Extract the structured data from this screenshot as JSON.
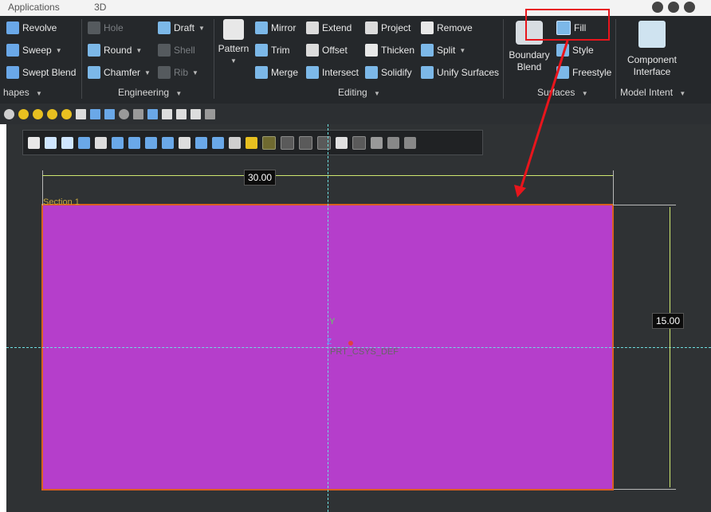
{
  "window": {
    "tab_applications": "Applications",
    "tab_3d": "3D"
  },
  "ribbon": {
    "shapes": {
      "revolve": "Revolve",
      "sweep": "Sweep",
      "swept_blend": "Swept Blend",
      "label": "hapes"
    },
    "engineering": {
      "hole": "Hole",
      "draft": "Draft",
      "round": "Round",
      "shell": "Shell",
      "chamfer": "Chamfer",
      "rib": "Rib",
      "label": "Engineering"
    },
    "editing": {
      "pattern": "Pattern",
      "mirror": "Mirror",
      "extend": "Extend",
      "project": "Project",
      "remove": "Remove",
      "trim": "Trim",
      "offset": "Offset",
      "thicken": "Thicken",
      "split": "Split",
      "merge": "Merge",
      "intersect": "Intersect",
      "solidify": "Solidify",
      "unify_surfaces": "Unify Surfaces",
      "label": "Editing"
    },
    "surfaces": {
      "fill": "Fill",
      "style": "Style",
      "freestyle": "Freestyle",
      "boundary_blend_line1": "Boundary",
      "boundary_blend_line2": "Blend",
      "label": "Surfaces"
    },
    "model_intent": {
      "component_interface_line1": "Component",
      "component_interface_line2": "Interface",
      "label": "Model Intent"
    }
  },
  "canvas": {
    "section_name": "Section 1",
    "dim_horizontal": "30.00",
    "dim_vertical": "15.00",
    "axis_y": "Y",
    "axis_z": "Z",
    "csys_name": "PRT_CSYS_DEF"
  },
  "colors": {
    "fill": "#b53ecb",
    "edge": "#d86020",
    "callout": "#e8151c",
    "ribbon": "#25282b",
    "canvas": "#2f3234"
  }
}
